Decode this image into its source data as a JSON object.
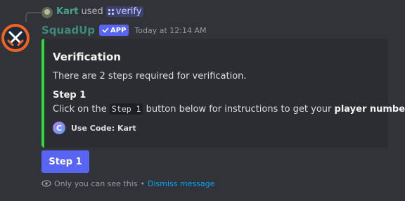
{
  "reply": {
    "user": "Kart",
    "used_text": "used",
    "command": "verify"
  },
  "message": {
    "bot_name": "SquadUp",
    "badge": "APP",
    "timestamp": "Today at 12:14 AM"
  },
  "embed": {
    "accent_color": "#2ddc3c",
    "title": "Verification",
    "description": "There are 2 steps required for verification.",
    "step_title": "Step 1",
    "step_text_before": "Click on the",
    "step_code": "Step 1",
    "step_text_after": "button below for instructions to get your",
    "step_bold": "player number",
    "step_text_end": ".",
    "footer_icon_letter": "C",
    "footer_text": "Use Code: Kart"
  },
  "button": {
    "label": "Step 1",
    "color": "#5865f2"
  },
  "ephemeral": {
    "notice": "Only you can see this",
    "separator": "•",
    "dismiss": "Dismiss message"
  },
  "icons": {
    "bot_avatar": "crossed-swords-icon",
    "badge": "checkmark-icon",
    "command": "grid-icon",
    "eye": "eye-icon"
  }
}
